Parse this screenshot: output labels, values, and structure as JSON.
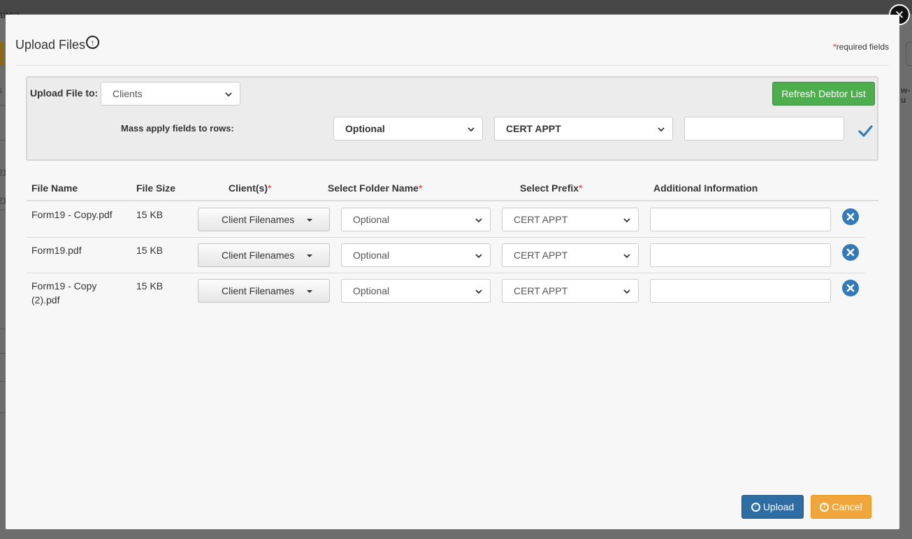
{
  "background": {
    "title_fragment": "ança",
    "right_fragment": "w-u",
    "left_fragments": [
      "s",
      "21",
      "21"
    ]
  },
  "modal": {
    "title": "Upload Files",
    "required_star": "*",
    "required_note": "required fields",
    "close_glyph": "✕",
    "title_icon_glyph": "↑"
  },
  "panel": {
    "upload_to_label": "Upload File to:",
    "upload_to_value": "Clients",
    "refresh_button": "Refresh Debtor List",
    "mass_apply_label": "Mass apply fields to rows:",
    "mass_folder_value": "Optional",
    "mass_prefix_value": "CERT APPT",
    "mass_info_value": ""
  },
  "table": {
    "headers": {
      "file_name": "File Name",
      "file_size": "File Size",
      "clients": "Client(s)",
      "folder": "Select Folder Name",
      "prefix": "Select Prefix",
      "additional": "Additional Information",
      "star": "*"
    },
    "rows": [
      {
        "file_name": "Form19 - Copy.pdf",
        "file_size": "15 KB",
        "clients_button": "Client Filenames",
        "folder": "Optional",
        "prefix": "CERT APPT",
        "additional": ""
      },
      {
        "file_name": "Form19.pdf",
        "file_size": "15 KB",
        "clients_button": "Client Filenames",
        "folder": "Optional",
        "prefix": "CERT APPT",
        "additional": ""
      },
      {
        "file_name": "Form19 - Copy\n(2).pdf",
        "file_size": "15 KB",
        "clients_button": "Client Filenames",
        "folder": "Optional",
        "prefix": "CERT APPT",
        "additional": ""
      }
    ]
  },
  "footer": {
    "upload_button": "Upload",
    "cancel_button": "Cancel"
  },
  "colors": {
    "primary": "#337ab7",
    "success": "#4cae4c",
    "warning": "#f0a63a",
    "required": "#c9302c"
  }
}
